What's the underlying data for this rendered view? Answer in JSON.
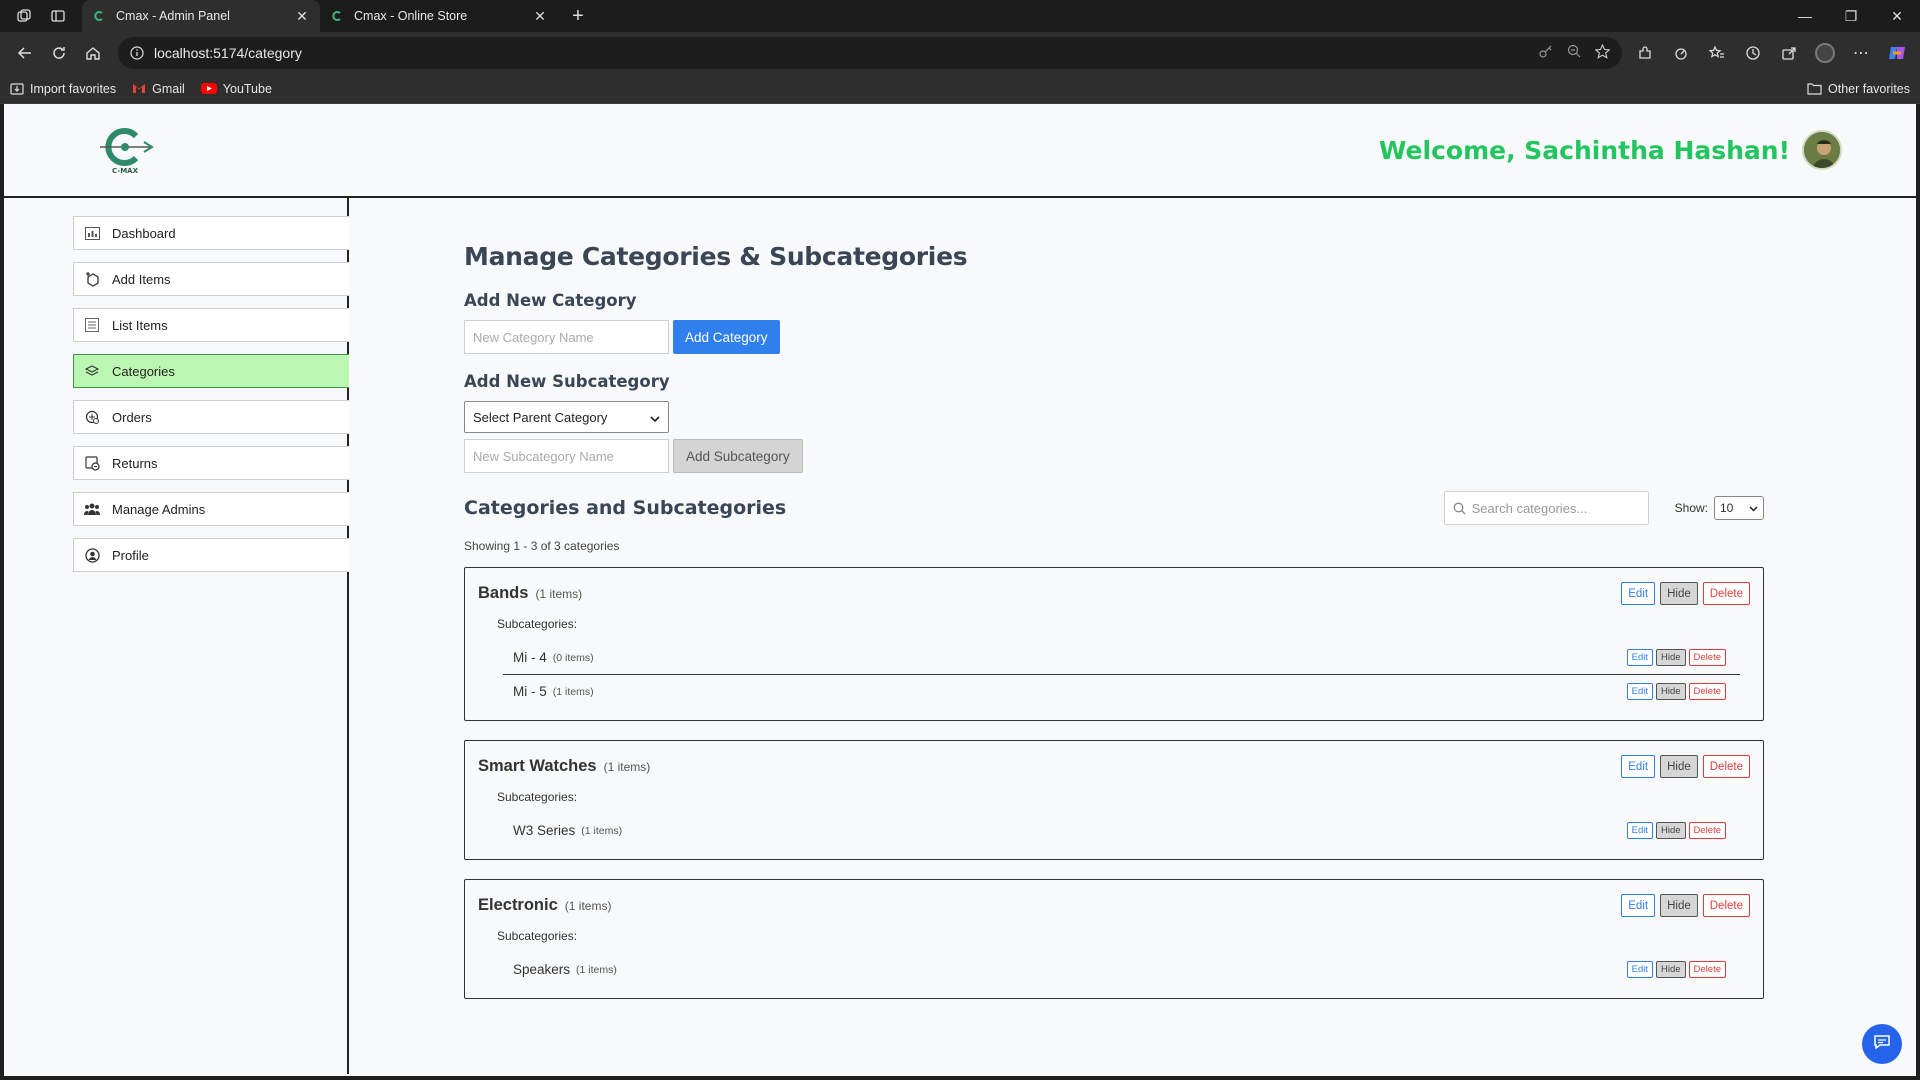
{
  "browser": {
    "tabs": [
      {
        "title": "Cmax - Admin Panel"
      },
      {
        "title": "Cmax - Online Store"
      }
    ],
    "url": "localhost:5174/category",
    "bookmarks": [
      {
        "label": "Import favorites"
      },
      {
        "label": "Gmail"
      },
      {
        "label": "YouTube"
      }
    ],
    "other_favorites": "Other favorites"
  },
  "header": {
    "logo_text": "C-MAX",
    "welcome": "Welcome, Sachintha Hashan!"
  },
  "sidebar": {
    "items": [
      {
        "label": "Dashboard",
        "icon": "dashboard-icon"
      },
      {
        "label": "Add Items",
        "icon": "add-items-icon"
      },
      {
        "label": "List Items",
        "icon": "list-icon"
      },
      {
        "label": "Categories",
        "icon": "layers-icon",
        "active": true
      },
      {
        "label": "Orders",
        "icon": "orders-icon"
      },
      {
        "label": "Returns",
        "icon": "returns-icon"
      },
      {
        "label": "Manage Admins",
        "icon": "users-icon"
      },
      {
        "label": "Profile",
        "icon": "profile-icon"
      }
    ]
  },
  "main": {
    "title": "Manage Categories & Subcategories",
    "add_category": {
      "heading": "Add New Category",
      "placeholder": "New Category Name",
      "button": "Add Category"
    },
    "add_subcategory": {
      "heading": "Add New Subcategory",
      "select_value": "Select Parent Category",
      "placeholder": "New Subcategory Name",
      "button": "Add Subcategory"
    },
    "list": {
      "heading": "Categories and Subcategories",
      "search_placeholder": "Search categories...",
      "show_label": "Show:",
      "show_value": "10",
      "showing": "Showing 1 - 3 of 3 categories",
      "subs_label": "Subcategories:",
      "actions": {
        "edit": "Edit",
        "hide": "Hide",
        "delete": "Delete"
      },
      "categories": [
        {
          "name": "Bands",
          "count": "(1 items)",
          "subs": [
            {
              "name": "Mi - 4",
              "count": "(0 items)"
            },
            {
              "name": "Mi - 5",
              "count": "(1 items)"
            }
          ]
        },
        {
          "name": "Smart Watches",
          "count": "(1 items)",
          "subs": [
            {
              "name": "W3 Series",
              "count": "(1 items)"
            }
          ]
        },
        {
          "name": "Electronic",
          "count": "(1 items)",
          "subs": [
            {
              "name": "Speakers",
              "count": "(1 items)"
            }
          ]
        }
      ]
    }
  },
  "colors": {
    "accent_green": "#22c55e",
    "primary_blue": "#2f80ed",
    "danger_red": "#e03b3b",
    "active_sidebar": "#bbf7b2"
  }
}
